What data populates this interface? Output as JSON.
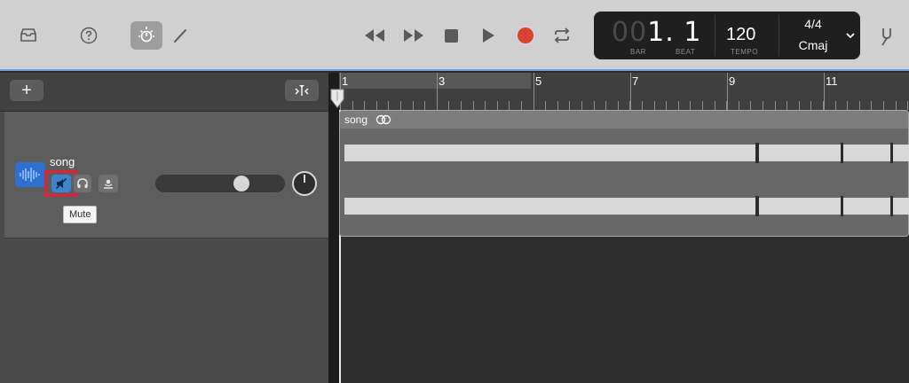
{
  "toolbar": {
    "icons": [
      "library-icon",
      "help-icon",
      "smart-controls-icon",
      "pencil-icon",
      "rewind-icon",
      "fast-forward-icon",
      "stop-icon",
      "play-icon",
      "record-icon",
      "cycle-icon",
      "tuner-icon"
    ],
    "record_color": "#d8432f"
  },
  "lcd": {
    "position_dim": "00",
    "position_bar": "1.",
    "position_beat": "1",
    "bar_label": "BAR",
    "beat_label": "BEAT",
    "tempo": "120",
    "tempo_label": "TEMPO",
    "time_signature": "4/4",
    "key": "Cmaj"
  },
  "track_header": {
    "add_label": "+"
  },
  "tracks": [
    {
      "name": "song",
      "mute_tooltip": "Mute",
      "volume": 0.69
    }
  ],
  "ruler": {
    "bars": [
      "1",
      "3",
      "5",
      "7",
      "9",
      "11"
    ]
  },
  "region": {
    "name": "song"
  },
  "colors": {
    "accent_blue": "#3f83cc",
    "track_icon": "#2f6fd0",
    "highlight_red": "#e0213a"
  }
}
